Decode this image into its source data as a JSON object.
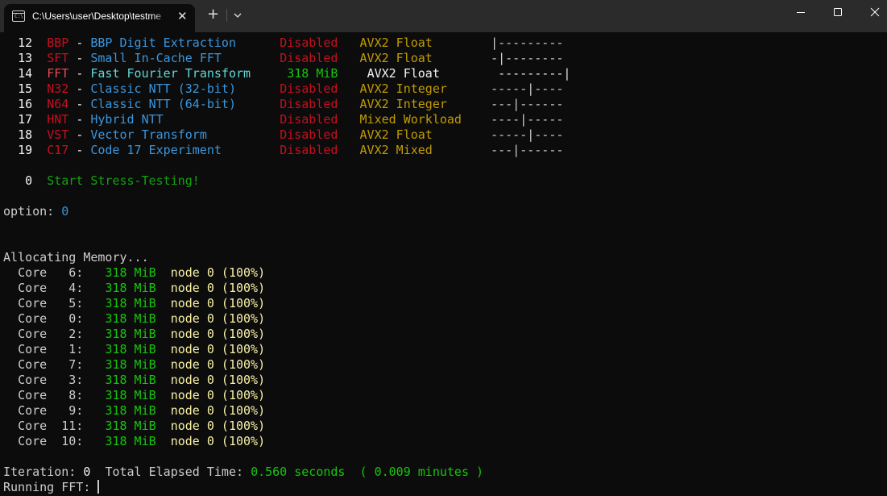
{
  "window": {
    "tab_title": "C:\\Users\\user\\Desktop\\testme",
    "tab_icon_prompt": "C:\\",
    "close_tab_glyph": "✕",
    "new_tab_glyph": "+",
    "colors": {
      "titlebar": "#2b2b2b",
      "terminal_bg": "#0c0c0c",
      "default_text": "#cccccc"
    }
  },
  "tests": [
    {
      "num": "12",
      "code": "BBP",
      "name": "BBP Digit Extraction",
      "status": "Disabled",
      "isa": "AVX2 Float",
      "meter": "|---------",
      "active": false
    },
    {
      "num": "13",
      "code": "SFT",
      "name": "Small In-Cache FFT",
      "status": "Disabled",
      "isa": "AVX2 Float",
      "meter": "-|--------",
      "active": false
    },
    {
      "num": "14",
      "code": "FFT",
      "name": "Fast Fourier Transform",
      "status": "318 MiB",
      "isa": "AVX2 Float",
      "meter": "---------|",
      "active": true
    },
    {
      "num": "15",
      "code": "N32",
      "name": "Classic NTT (32-bit)",
      "status": "Disabled",
      "isa": "AVX2 Integer",
      "meter": "-----|----",
      "active": false
    },
    {
      "num": "16",
      "code": "N64",
      "name": "Classic NTT (64-bit)",
      "status": "Disabled",
      "isa": "AVX2 Integer",
      "meter": "---|------",
      "active": false
    },
    {
      "num": "17",
      "code": "HNT",
      "name": "Hybrid NTT",
      "status": "Disabled",
      "isa": "Mixed Workload",
      "meter": "----|-----",
      "active": false
    },
    {
      "num": "18",
      "code": "VST",
      "name": "Vector Transform",
      "status": "Disabled",
      "isa": "AVX2 Float",
      "meter": "-----|----",
      "active": false
    },
    {
      "num": "19",
      "code": "C17",
      "name": "Code 17 Experiment",
      "status": "Disabled",
      "isa": "AVX2 Mixed",
      "meter": "---|------",
      "active": false
    }
  ],
  "dash": "-",
  "start": {
    "num": "0",
    "label": "Start Stress-Testing!"
  },
  "option": {
    "label": "option:",
    "value": "0"
  },
  "allocating": "Allocating Memory...",
  "core_label": "Core",
  "cores": [
    {
      "id": "6:",
      "mem": "318 MiB",
      "node": "node 0 (100%)"
    },
    {
      "id": "4:",
      "mem": "318 MiB",
      "node": "node 0 (100%)"
    },
    {
      "id": "5:",
      "mem": "318 MiB",
      "node": "node 0 (100%)"
    },
    {
      "id": "0:",
      "mem": "318 MiB",
      "node": "node 0 (100%)"
    },
    {
      "id": "2:",
      "mem": "318 MiB",
      "node": "node 0 (100%)"
    },
    {
      "id": "1:",
      "mem": "318 MiB",
      "node": "node 0 (100%)"
    },
    {
      "id": "7:",
      "mem": "318 MiB",
      "node": "node 0 (100%)"
    },
    {
      "id": "3:",
      "mem": "318 MiB",
      "node": "node 0 (100%)"
    },
    {
      "id": "8:",
      "mem": "318 MiB",
      "node": "node 0 (100%)"
    },
    {
      "id": "9:",
      "mem": "318 MiB",
      "node": "node 0 (100%)"
    },
    {
      "id": "11:",
      "mem": "318 MiB",
      "node": "node 0 (100%)"
    },
    {
      "id": "10:",
      "mem": "318 MiB",
      "node": "node 0 (100%)"
    }
  ],
  "iteration": {
    "label": "Iteration:",
    "value": "0",
    "elapsed_label": "Total Elapsed Time:",
    "elapsed_value": "0.560 seconds",
    "minutes_open": "(",
    "minutes_value": "0.009 minutes",
    "minutes_close": ")"
  },
  "running": {
    "label": "Running FFT:"
  }
}
